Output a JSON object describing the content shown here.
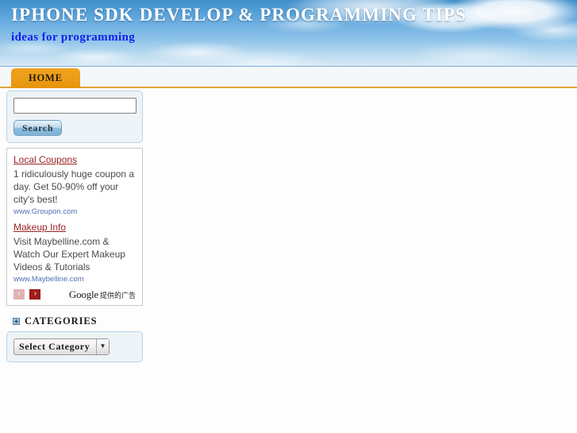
{
  "header": {
    "title": "IPHONE SDK DEVELOP & PROGRAMMING TIPS",
    "tagline": "ideas for programming",
    "background": "sky-clouds-photo"
  },
  "nav": {
    "items": [
      {
        "label": "HOME",
        "active": true
      }
    ]
  },
  "sidebar": {
    "search": {
      "value": "",
      "placeholder": "",
      "button_label": "Search"
    },
    "ads": {
      "items": [
        {
          "title": "Local Coupons",
          "body": "1 ridiculously huge coupon a day. Get 50-90% off your city's best!",
          "url": "www.Groupon.com"
        },
        {
          "title": "Makeup Info",
          "body": "Visit Maybelline.com & Watch Our Expert Makeup Videos & Tutorials",
          "url": "www.Maybelline.com"
        }
      ],
      "prev_label": "‹",
      "next_label": "›",
      "brand_word": "Google",
      "brand_note": "提供的广告"
    },
    "categories": {
      "heading": "CATEGORIES",
      "expand_icon": "plus-box-icon",
      "select_value": "Select Category",
      "select_arrow": "▼"
    }
  },
  "colors": {
    "tab_orange": "#eb9c18",
    "nav_border_bottom": "#e0a33a",
    "nav_border_top": "#7cb0d6",
    "tagline_blue": "#1020ee",
    "ad_title_red": "#9b2424",
    "ad_url_blue": "#4f6fb5",
    "widget_bg": "#eef3f7",
    "widget_border": "#b9d2e4",
    "sky_blue": "#4f9bd8"
  }
}
